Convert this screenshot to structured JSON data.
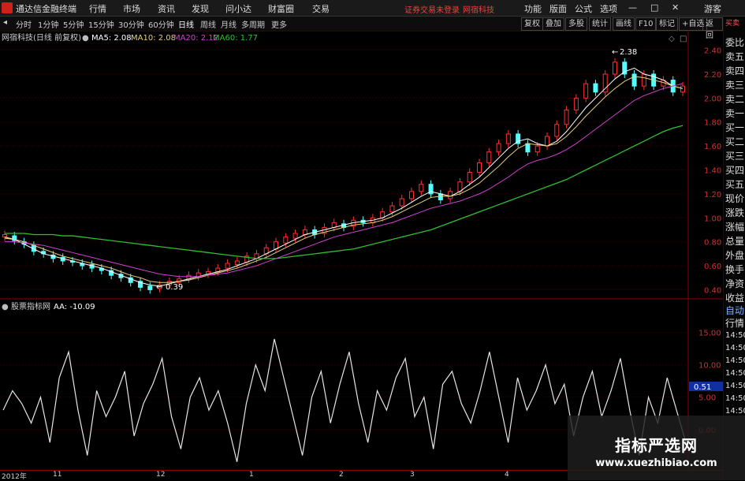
{
  "menubar": {
    "app_title": "通达信金融终端",
    "items": [
      "行情",
      "市场",
      "资讯",
      "发现",
      "问小达",
      "财富圈",
      "交易"
    ],
    "notice": "证券交易未登录",
    "notice2": "网宿科技",
    "right_items": [
      "功能",
      "版面",
      "公式",
      "选项"
    ],
    "guest": "游客"
  },
  "toolbar": {
    "periods": [
      "分时",
      "1分钟",
      "5分钟",
      "15分钟",
      "30分钟",
      "60分钟",
      "日线",
      "周线",
      "月线",
      "多周期",
      "更多"
    ],
    "active_period": "日线",
    "right_buttons": [
      "复权",
      "叠加",
      "多股",
      "统计",
      "画线",
      "F10",
      "标记",
      "+自选",
      "返回"
    ]
  },
  "main_chart": {
    "stock_label": "网宿科技(日线 前复权)",
    "ma5": "MA5: 2.08",
    "ma10": "MA10: 2.08",
    "ma20": "MA20: 2.12",
    "ma60": "MA60: 1.77",
    "high_label": "2.38",
    "low_label": "0.39",
    "y_ticks": [
      "2.40",
      "2.20",
      "2.00",
      "1.80",
      "1.60",
      "1.40",
      "1.20",
      "1.00",
      "0.80",
      "0.60",
      "0.40"
    ],
    "colors": {
      "ma5": "#ffffff",
      "ma10": "#e8d07a",
      "ma20": "#d040d0",
      "ma60": "#2fbf2f",
      "up": "#ff3030",
      "down": "#54ffff"
    }
  },
  "indicator": {
    "name": "股票指标网",
    "value": "AA: -10.09",
    "y_ticks": [
      "15.00",
      "10.00",
      "5.00",
      "0.00"
    ],
    "current_tag": "0.51"
  },
  "x_axis": {
    "labels": [
      "2012年",
      "11",
      "12",
      "1",
      "2",
      "3",
      "4"
    ]
  },
  "side_panel": {
    "header": "买卖",
    "items": [
      "委比",
      "卖五",
      "卖四",
      "卖三",
      "卖二",
      "卖一",
      "买一",
      "买二",
      "买三",
      "买四",
      "买五",
      "现价",
      "涨跌",
      "涨幅",
      "总量",
      "外盘",
      "换手",
      "净资",
      "收益"
    ],
    "lower_items": [
      "自动",
      "行情",
      "14:50",
      "14:50",
      "14:50",
      "14:50",
      "14:50",
      "14:50",
      "14:50"
    ]
  },
  "watermark": {
    "title": "指标严选网",
    "url": "www.xuezhibiao.com"
  },
  "chart_data": {
    "type": "candlestick",
    "ylim": [
      0.35,
      2.45
    ],
    "series": [
      {
        "name": "MA5",
        "values": [
          0.84,
          0.82,
          0.78,
          0.74,
          0.7,
          0.68,
          0.66,
          0.64,
          0.62,
          0.6,
          0.58,
          0.55,
          0.52,
          0.49,
          0.46,
          0.44,
          0.43,
          0.45,
          0.47,
          0.49,
          0.51,
          0.53,
          0.55,
          0.57,
          0.6,
          0.63,
          0.66,
          0.7,
          0.74,
          0.78,
          0.82,
          0.86,
          0.88,
          0.9,
          0.92,
          0.94,
          0.96,
          0.97,
          0.98,
          1.0,
          1.04,
          1.08,
          1.13,
          1.18,
          1.22,
          1.2,
          1.18,
          1.22,
          1.28,
          1.34,
          1.42,
          1.5,
          1.58,
          1.64,
          1.66,
          1.62,
          1.6,
          1.64,
          1.72,
          1.82,
          1.92,
          2.0,
          2.08,
          2.16,
          2.22,
          2.25,
          2.2,
          2.18,
          2.15,
          2.1,
          2.08
        ]
      },
      {
        "name": "MA10",
        "values": [
          0.83,
          0.82,
          0.8,
          0.77,
          0.74,
          0.71,
          0.68,
          0.66,
          0.64,
          0.62,
          0.6,
          0.58,
          0.55,
          0.52,
          0.5,
          0.47,
          0.46,
          0.46,
          0.47,
          0.48,
          0.5,
          0.52,
          0.54,
          0.56,
          0.58,
          0.61,
          0.64,
          0.67,
          0.71,
          0.75,
          0.79,
          0.83,
          0.86,
          0.88,
          0.9,
          0.92,
          0.94,
          0.95,
          0.96,
          0.98,
          1.01,
          1.05,
          1.09,
          1.13,
          1.17,
          1.18,
          1.18,
          1.2,
          1.24,
          1.29,
          1.36,
          1.43,
          1.51,
          1.58,
          1.62,
          1.61,
          1.6,
          1.62,
          1.68,
          1.76,
          1.85,
          1.93,
          2.01,
          2.08,
          2.14,
          2.18,
          2.17,
          2.15,
          2.13,
          2.1,
          2.08
        ]
      },
      {
        "name": "MA20",
        "values": [
          0.8,
          0.8,
          0.79,
          0.78,
          0.77,
          0.75,
          0.73,
          0.71,
          0.69,
          0.67,
          0.65,
          0.63,
          0.61,
          0.59,
          0.57,
          0.55,
          0.53,
          0.52,
          0.51,
          0.51,
          0.51,
          0.52,
          0.53,
          0.54,
          0.56,
          0.58,
          0.6,
          0.63,
          0.66,
          0.69,
          0.72,
          0.75,
          0.78,
          0.81,
          0.84,
          0.86,
          0.88,
          0.9,
          0.92,
          0.94,
          0.96,
          0.99,
          1.02,
          1.05,
          1.08,
          1.1,
          1.12,
          1.14,
          1.17,
          1.2,
          1.24,
          1.29,
          1.34,
          1.4,
          1.45,
          1.48,
          1.5,
          1.53,
          1.57,
          1.62,
          1.68,
          1.74,
          1.8,
          1.86,
          1.92,
          1.98,
          2.02,
          2.05,
          2.08,
          2.1,
          2.12
        ]
      },
      {
        "name": "MA60",
        "values": [
          0.87,
          0.87,
          0.87,
          0.86,
          0.86,
          0.86,
          0.85,
          0.85,
          0.84,
          0.83,
          0.82,
          0.81,
          0.8,
          0.79,
          0.78,
          0.77,
          0.76,
          0.75,
          0.74,
          0.73,
          0.72,
          0.71,
          0.7,
          0.69,
          0.68,
          0.67,
          0.66,
          0.66,
          0.66,
          0.67,
          0.68,
          0.69,
          0.7,
          0.71,
          0.72,
          0.73,
          0.74,
          0.76,
          0.78,
          0.8,
          0.82,
          0.84,
          0.86,
          0.88,
          0.9,
          0.93,
          0.96,
          0.99,
          1.02,
          1.05,
          1.08,
          1.11,
          1.14,
          1.17,
          1.2,
          1.23,
          1.26,
          1.29,
          1.32,
          1.36,
          1.4,
          1.44,
          1.48,
          1.52,
          1.56,
          1.6,
          1.64,
          1.68,
          1.72,
          1.75,
          1.77
        ]
      }
    ],
    "candles": [
      [
        0.84,
        0.86
      ],
      [
        0.85,
        0.81
      ],
      [
        0.8,
        0.78
      ],
      [
        0.77,
        0.72
      ],
      [
        0.72,
        0.7
      ],
      [
        0.69,
        0.66
      ],
      [
        0.67,
        0.64
      ],
      [
        0.64,
        0.63
      ],
      [
        0.62,
        0.6
      ],
      [
        0.61,
        0.58
      ],
      [
        0.58,
        0.56
      ],
      [
        0.56,
        0.52
      ],
      [
        0.53,
        0.5
      ],
      [
        0.5,
        0.46
      ],
      [
        0.47,
        0.42
      ],
      [
        0.43,
        0.4
      ],
      [
        0.41,
        0.44
      ],
      [
        0.44,
        0.47
      ],
      [
        0.46,
        0.49
      ],
      [
        0.49,
        0.52
      ],
      [
        0.51,
        0.54
      ],
      [
        0.53,
        0.55
      ],
      [
        0.55,
        0.58
      ],
      [
        0.58,
        0.62
      ],
      [
        0.61,
        0.64
      ],
      [
        0.63,
        0.68
      ],
      [
        0.66,
        0.7
      ],
      [
        0.7,
        0.75
      ],
      [
        0.74,
        0.8
      ],
      [
        0.79,
        0.84
      ],
      [
        0.83,
        0.87
      ],
      [
        0.86,
        0.9
      ],
      [
        0.9,
        0.86
      ],
      [
        0.87,
        0.92
      ],
      [
        0.92,
        0.96
      ],
      [
        0.95,
        0.92
      ],
      [
        0.93,
        0.98
      ],
      [
        0.98,
        0.96
      ],
      [
        0.96,
        1.0
      ],
      [
        1.0,
        1.05
      ],
      [
        1.05,
        1.1
      ],
      [
        1.1,
        1.16
      ],
      [
        1.16,
        1.22
      ],
      [
        1.22,
        1.28
      ],
      [
        1.28,
        1.2
      ],
      [
        1.2,
        1.15
      ],
      [
        1.16,
        1.22
      ],
      [
        1.22,
        1.3
      ],
      [
        1.3,
        1.38
      ],
      [
        1.38,
        1.46
      ],
      [
        1.46,
        1.55
      ],
      [
        1.55,
        1.62
      ],
      [
        1.62,
        1.7
      ],
      [
        1.7,
        1.62
      ],
      [
        1.62,
        1.55
      ],
      [
        1.55,
        1.6
      ],
      [
        1.6,
        1.68
      ],
      [
        1.68,
        1.78
      ],
      [
        1.78,
        1.9
      ],
      [
        1.9,
        2.0
      ],
      [
        2.0,
        2.12
      ],
      [
        2.12,
        2.05
      ],
      [
        2.05,
        2.2
      ],
      [
        2.2,
        2.3
      ],
      [
        2.3,
        2.2
      ],
      [
        2.2,
        2.1
      ],
      [
        2.1,
        2.2
      ],
      [
        2.2,
        2.1
      ],
      [
        2.1,
        2.15
      ],
      [
        2.15,
        2.05
      ],
      [
        2.05,
        2.1
      ]
    ],
    "indicator_ylim": [
      -6,
      18
    ],
    "indicator_values": [
      3,
      6,
      4,
      1,
      5,
      -2,
      8,
      12,
      3,
      -4,
      6,
      2,
      5,
      9,
      -1,
      4,
      7,
      11,
      2,
      -3,
      5,
      8,
      3,
      6,
      1,
      -5,
      4,
      10,
      6,
      14,
      8,
      2,
      -4,
      5,
      9,
      1,
      7,
      12,
      4,
      -2,
      6,
      3,
      8,
      11,
      2,
      5,
      -3,
      7,
      9,
      4,
      1,
      6,
      12,
      5,
      -2,
      8,
      3,
      6,
      10,
      4,
      7,
      -1,
      5,
      9,
      2,
      6,
      11,
      3,
      -4,
      5,
      1,
      8,
      3,
      -2
    ]
  }
}
